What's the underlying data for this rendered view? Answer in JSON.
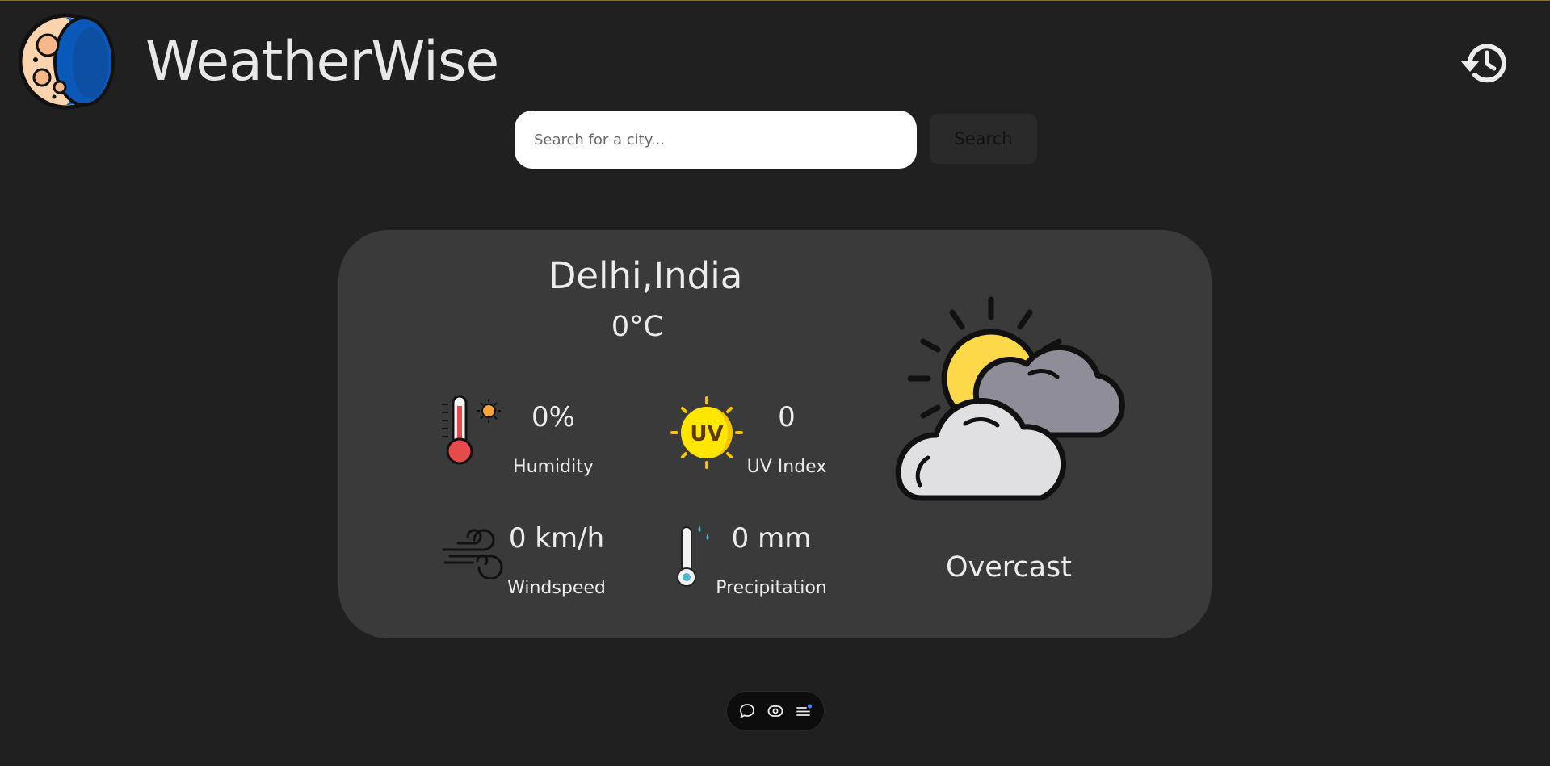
{
  "header": {
    "title": "WeatherWise",
    "logo_icon": "moon-logo-icon",
    "history_icon": "history-icon"
  },
  "search": {
    "placeholder": "Search for a city...",
    "value": "",
    "button_label": "Search"
  },
  "weather": {
    "location": "Delhi,India",
    "temperature": "0°C",
    "condition": "Overcast",
    "condition_icon": "partly-cloudy-icon",
    "stats": {
      "humidity": {
        "value": "0%",
        "label": "Humidity",
        "icon": "thermometer-sun-icon"
      },
      "uv_index": {
        "value": "0",
        "label": "UV Index",
        "icon": "uv-sun-icon"
      },
      "windspeed": {
        "value": "0 km/h",
        "label": "Windspeed",
        "icon": "wind-icon"
      },
      "precipitation": {
        "value": "0 mm",
        "label": "Precipitation",
        "icon": "thermometer-rain-icon"
      }
    }
  },
  "toolbar": {
    "icons": [
      "chat-bubble-icon",
      "eye-icon",
      "list-icon"
    ]
  },
  "colors": {
    "background": "#202020",
    "card": "#3a3a3a",
    "text": "#e6e6e6",
    "logo_blue": "#0a58b8",
    "sun_yellow": "#fdd848"
  }
}
